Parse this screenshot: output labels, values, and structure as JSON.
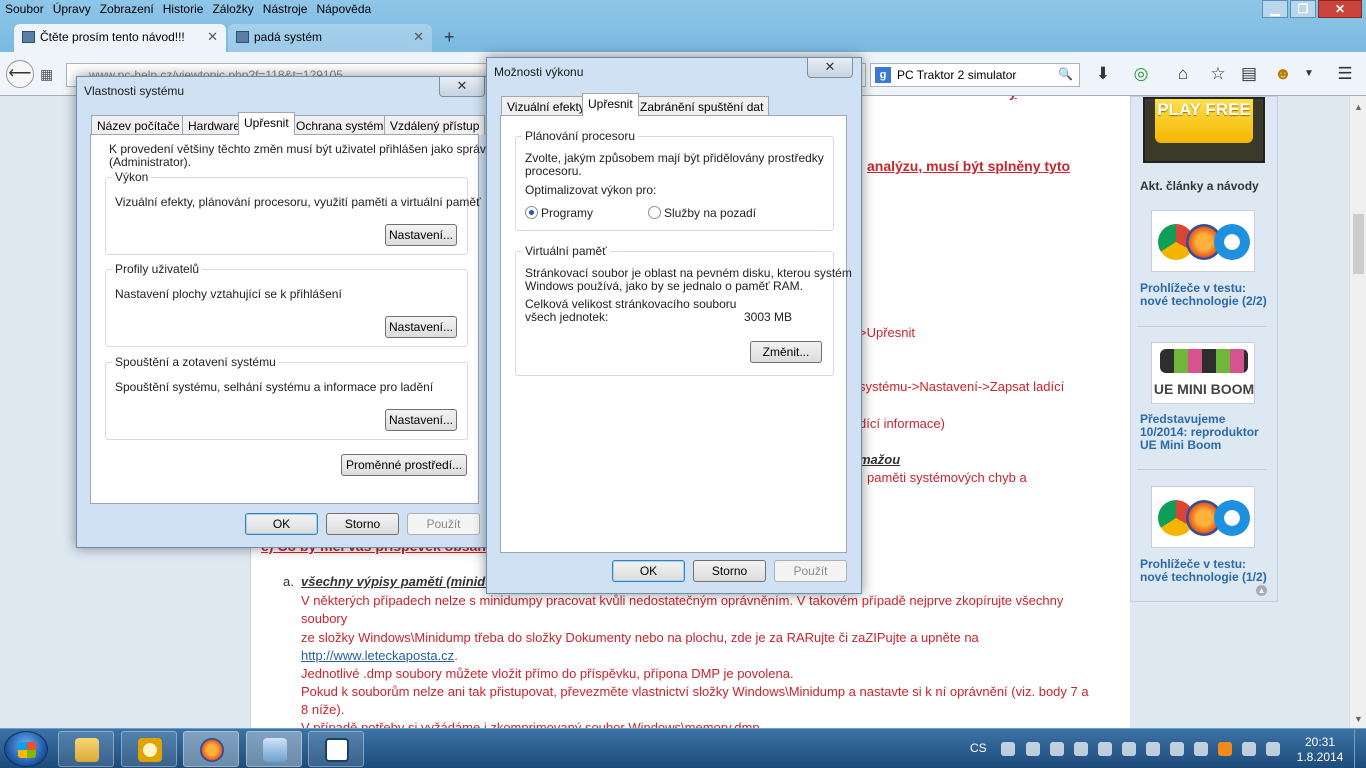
{
  "menubar": [
    "Soubor",
    "Úpravy",
    "Zobrazení",
    "Historie",
    "Záložky",
    "Nástroje",
    "Nápověda"
  ],
  "window_controls": {
    "minimize": "▁",
    "restore": "❐",
    "close": "✕"
  },
  "tabs": [
    {
      "label": "Čtěte prosím tento návod!!!",
      "active": true
    },
    {
      "label": "padá systém",
      "active": false
    }
  ],
  "new_tab_symbol": "+",
  "nav": {
    "url": "www.pc-help.cz/viewtopic.php?f=118&t=129105",
    "search_value": "PC Traktor 2 simulator",
    "search_engine": "g"
  },
  "page": {
    "heading_fragment": "y",
    "analysis_heading": "analýzu, musí být splněny tyto",
    "line_upresnit": ">Upřesnit",
    "line_nastaveni": "systému->Nastavení->Zapsat ladící",
    "line_ladici": "dící informace)",
    "line_mazou": "mažou",
    "line_pameti": "paměti systémových chyb a",
    "section_e": "e) Co by měl váš příspěvek obsahovat",
    "item_a_marker": "a.",
    "item_a_title": "všechny výpisy paměti (minidumpy)",
    "para": [
      "V některých případech nelze s minidumpy pracovat kvůli nedostatečným oprávněním. V takovém případě nejprve zkopírujte všechny",
      "soubory",
      "ze složky Windows\\Minidump třeba do složky Dokumenty nebo na plochu, zde je za RARujte či zaZIPujte a upněte na",
      "Jednotlivé .dmp soubory můžete vložit přímo do příspěvku, přípona DMP je povolena.",
      "Pokud k souborům nelze ani tak přistupovat, převezměte vlastnictví složky Windows\\Minidump a nastavte si k ní oprávnění (viz. body 7 a",
      "8 níže).",
      "V případě potřeby si vyžádáme i zkomprimovaný soubor Windows\\memory.dmp"
    ],
    "link": "http://www.leteckaposta.cz",
    "link_suffix": "."
  },
  "sidebar": {
    "ad_text": "PLAY FREE",
    "title": "Akt. články a návody",
    "articles": [
      {
        "label": "Prohlížeče v testu: nové technologie (2/2)"
      },
      {
        "label": "Představujeme 10/2014: reproduktor UE Mini Boom",
        "image_text": "UE MINI BOOM"
      },
      {
        "label": "Prohlížeče v testu: nové technologie (1/2)"
      }
    ]
  },
  "dialog_system": {
    "title": "Vlastnosti systému",
    "close": "✕",
    "tabs": [
      "Název počítače",
      "Hardware",
      "Upřesnit",
      "Ochrana systému",
      "Vzdálený přístup"
    ],
    "admin_note_1": "K provedení většiny těchto změn musí být uživatel přihlášen jako správce",
    "admin_note_2": "(Administrator).",
    "groups": [
      {
        "title": "Výkon",
        "text": "Vizuální efekty, plánování procesoru, využití paměti a virtuální paměť",
        "button": "Nastavení..."
      },
      {
        "title": "Profily uživatelů",
        "text": "Nastavení plochy vztahující se k přihlášení",
        "button": "Nastavení..."
      },
      {
        "title": "Spouštění a zotavení systému",
        "text": "Spouštění systému, selhání systému a informace pro ladění",
        "button": "Nastavení..."
      }
    ],
    "env_button": "Proměnné prostředí...",
    "ok": "OK",
    "cancel": "Storno",
    "apply": "Použít"
  },
  "dialog_perf": {
    "title": "Možnosti výkonu",
    "close": "✕",
    "tabs": [
      "Vizuální efekty",
      "Upřesnit",
      "Zabránění spuštění dat"
    ],
    "cpu_group": {
      "title": "Plánování procesoru",
      "text_1": "Zvolte, jakým způsobem mají být přidělovány prostředky",
      "text_2": "procesoru.",
      "optimize_label": "Optimalizovat výkon pro:",
      "radio_programs": "Programy",
      "radio_background": "Služby na pozadí",
      "selected": "programs"
    },
    "vm_group": {
      "title": "Virtuální paměť",
      "text_1": "Stránkovací soubor je oblast na pevném disku, kterou systém",
      "text_2": "Windows používá, jako by se jednalo o paměť RAM.",
      "total_label_1": "Celková velikost stránkovacího souboru",
      "total_label_2": "všech jednotek:",
      "total_value": "3003 MB",
      "change_button": "Změnit..."
    },
    "ok": "OK",
    "cancel": "Storno",
    "apply": "Použít"
  },
  "taskbar": {
    "language": "CS",
    "time": "20:31",
    "date": "1.8.2014"
  }
}
